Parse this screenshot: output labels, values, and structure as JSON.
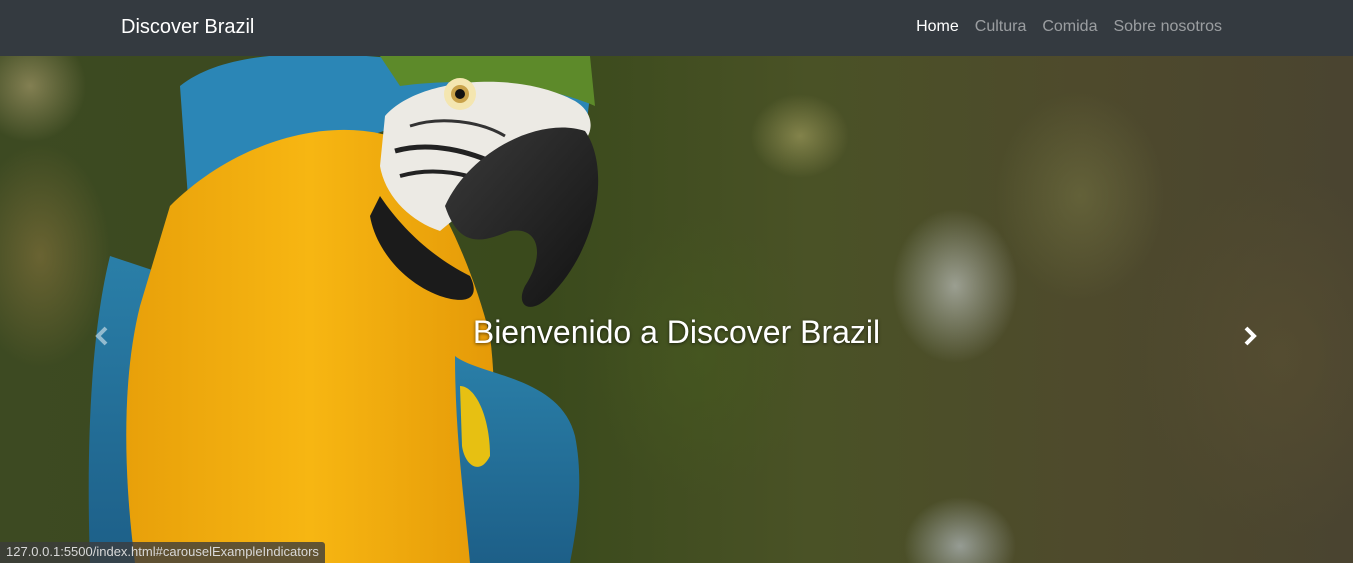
{
  "navbar": {
    "brand": "Discover Brazil",
    "items": [
      {
        "label": "Home",
        "active": true
      },
      {
        "label": "Cultura",
        "active": false
      },
      {
        "label": "Comida",
        "active": false
      },
      {
        "label": "Sobre nosotros",
        "active": false
      }
    ]
  },
  "carousel": {
    "caption": "Bienvenido a Discover Brazil",
    "prev_icon": "chevron-left-icon",
    "next_icon": "chevron-right-icon"
  },
  "status_bar": {
    "url": "127.0.0.1:5500/index.html#carouselExampleIndicators"
  },
  "colors": {
    "navbar_bg": "#343a40",
    "brand": "#ffffff",
    "nav_inactive": "rgba(255,255,255,0.5)"
  }
}
